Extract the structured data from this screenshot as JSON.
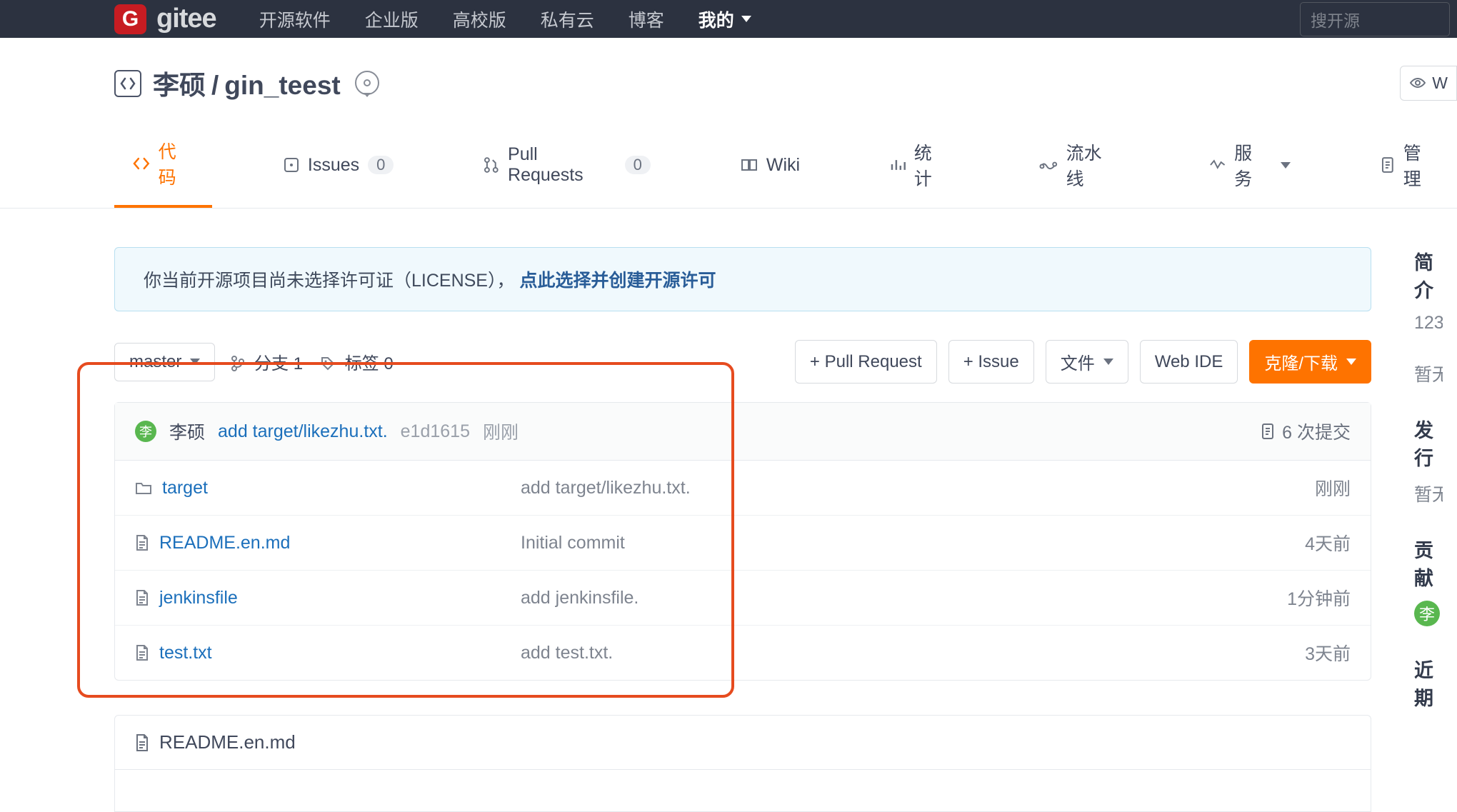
{
  "header": {
    "logo_text": "gitee",
    "nav": [
      "开源软件",
      "企业版",
      "高校版",
      "私有云",
      "博客"
    ],
    "nav_mine": "我的",
    "search_placeholder": "搜开源"
  },
  "repo": {
    "owner": "李硕",
    "name": "gin_teest",
    "watch_label": "W"
  },
  "tabs": {
    "code": "代码",
    "issues": "Issues",
    "issues_count": "0",
    "pr": "Pull Requests",
    "pr_count": "0",
    "wiki": "Wiki",
    "stats": "统计",
    "pipeline": "流水线",
    "services": "服务",
    "manage": "管理"
  },
  "license": {
    "text": "你当前开源项目尚未选择许可证（LICENSE），",
    "link": "点此选择并创建开源许可"
  },
  "toolbar": {
    "branch": "master",
    "branch_label": "分支",
    "branch_count": "1",
    "tag_label": "标签",
    "tag_count": "0",
    "pr_btn": "+ Pull Request",
    "issue_btn": "+ Issue",
    "file_btn": "文件",
    "webide_btn": "Web IDE",
    "clone_btn": "克隆/下载"
  },
  "latest_commit": {
    "avatar_initial": "李",
    "author": "李硕",
    "message": "add target/likezhu.txt.",
    "sha": "e1d1615",
    "time": "刚刚",
    "commits_count": "6 次提交"
  },
  "files": [
    {
      "icon": "folder",
      "name": "target",
      "msg": "add target/likezhu.txt.",
      "time": "刚刚"
    },
    {
      "icon": "file",
      "name": "README.en.md",
      "msg": "Initial commit",
      "time": "4天前"
    },
    {
      "icon": "file",
      "name": "jenkinsfile",
      "msg": "add jenkinsfile.",
      "time": "1分钟前"
    },
    {
      "icon": "file",
      "name": "test.txt",
      "msg": "add test.txt.",
      "time": "3天前"
    }
  ],
  "readme": {
    "title": "README.en.md"
  },
  "sidebar": {
    "intro_h": "简介",
    "intro_txt": "123",
    "intro_none": "暂无",
    "release_h": "发行",
    "release_none": "暂无",
    "contrib_h": "贡献",
    "contrib_initial": "李",
    "recent_h": "近期"
  }
}
